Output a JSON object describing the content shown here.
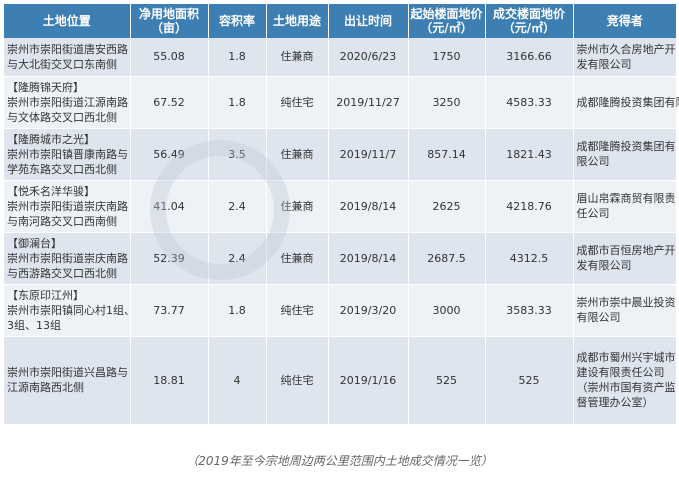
{
  "headers": [
    "土地位置",
    "净用地面积",
    "（亩）",
    "容积率",
    "土地用途",
    "出让时间",
    "起始楼面地价",
    "（元/㎡）",
    "成交楼面地价",
    "（元/㎡）",
    "竞得者"
  ],
  "rows": [
    {
      "loc": [
        "崇州市崇阳街道唐安西路",
        "与大北街交叉口东南侧"
      ],
      "area": "55.08",
      "far": "1.8",
      "use": "住兼商",
      "date": "2020/6/23",
      "start": "1750",
      "deal": "3166.66",
      "winner": [
        "崇州市久合房地产开",
        "发有限公司"
      ]
    },
    {
      "loc": [
        "【隆腾锦天府】",
        "崇州市崇阳街道江源南路",
        "与文体路交叉口西北侧"
      ],
      "area": "67.52",
      "far": "1.8",
      "use": "纯住宅",
      "date": "2019/11/27",
      "start": "3250",
      "deal": "4583.33",
      "winner": [
        "成都隆腾投资集团有限公司"
      ]
    },
    {
      "loc": [
        "【隆腾城市之光】",
        "崇州市崇阳镇晋康南路与",
        "学苑东路交叉口西北侧"
      ],
      "area": "56.49",
      "far": "3.5",
      "use": "住兼商",
      "date": "2019/11/7",
      "start": "857.14",
      "deal": "1821.43",
      "winner": [
        "成都隆腾投资集团有",
        "限公司"
      ]
    },
    {
      "loc": [
        "【悦禾名洋华骏】",
        "崇州市崇阳街道崇庆南路",
        "与南河路交叉口西南侧"
      ],
      "area": "41.04",
      "far": "2.4",
      "use": "住兼商",
      "date": "2019/8/14",
      "start": "2625",
      "deal": "4218.76",
      "winner": [
        "眉山帛霖商贸有限责",
        "任公司"
      ]
    },
    {
      "loc": [
        "【御澜台】",
        "崇州市崇阳街道崇庆南路",
        "与西游路交叉口西北侧"
      ],
      "area": "52.39",
      "far": "2.4",
      "use": "住兼商",
      "date": "2019/8/14",
      "start": "2687.5",
      "deal": "4312.5",
      "winner": [
        "成都市百恒房地产开",
        "发有限公司"
      ]
    },
    {
      "loc": [
        "【东原印江州】",
        "崇州市崇阳镇同心村1组、",
        "3组、13组"
      ],
      "area": "73.77",
      "far": "1.8",
      "use": "纯住宅",
      "date": "2019/3/20",
      "start": "3000",
      "deal": "3583.33",
      "winner": [
        "崇州市崇中晨业投资",
        "有限公司"
      ]
    },
    {
      "loc": [
        "崇州市崇阳街道兴昌路与",
        "江源南路西北侧"
      ],
      "area": "18.81",
      "far": "4",
      "use": "纯住宅",
      "date": "2019/1/16",
      "start": "525",
      "deal": "525",
      "winner": [
        "成都市蜀州兴宇城市",
        "建设有限责任公司",
        "（崇州市国有资产监",
        "督管理办公室）"
      ]
    }
  ],
  "caption": "（2019年至今宗地周边两公里范围内土地成交情况一览）",
  "watermark": {
    "text": "eallyinfo",
    "cn": "锐理数据"
  }
}
